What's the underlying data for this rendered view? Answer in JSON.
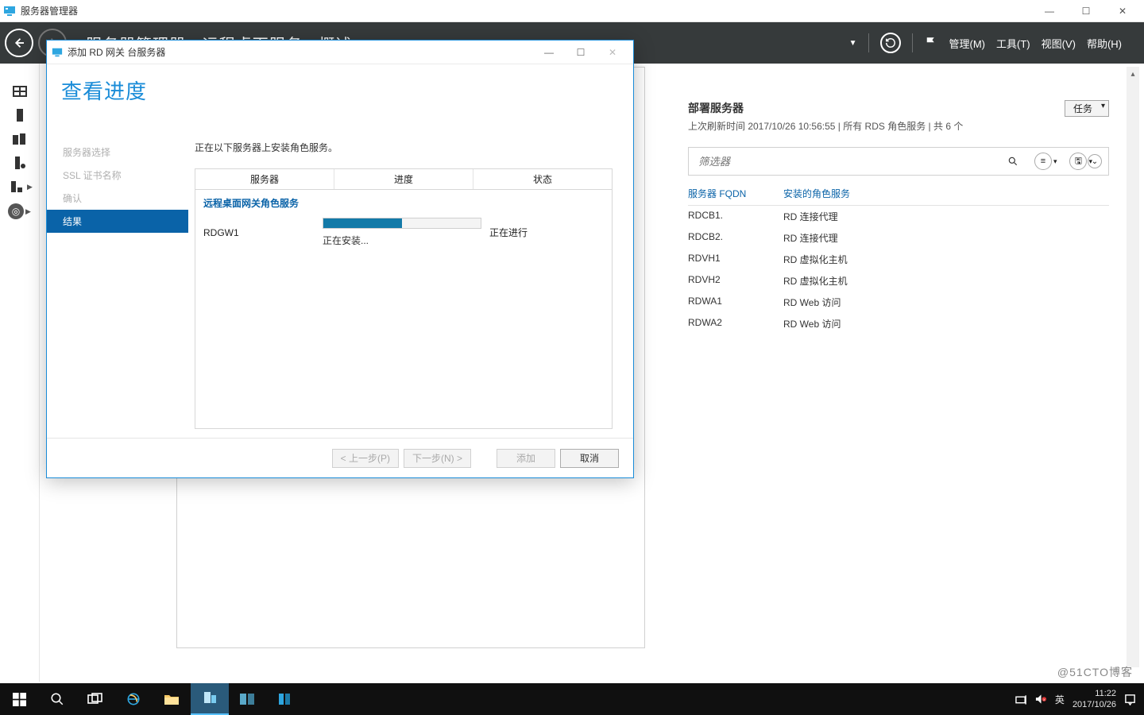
{
  "window": {
    "title": "服务器管理器",
    "breadcrumb": "服务器管理器 · 远程桌面服务 · 概述"
  },
  "header_menu": {
    "manage": "管理(M)",
    "tools": "工具(T)",
    "view": "视图(V)",
    "help": "帮助(H)"
  },
  "deploy": {
    "title": "部署服务器",
    "subline": "上次刷新时间 2017/10/26 10:56:55 | 所有 RDS 角色服务  | 共 6 个",
    "tasks": "任务",
    "filter_placeholder": "筛选器",
    "col_fqdn": "服务器 FQDN",
    "col_role": "安装的角色服务",
    "rows": [
      {
        "fqdn": "RDCB1.",
        "role": "RD 连接代理"
      },
      {
        "fqdn": "RDCB2.",
        "role": "RD 连接代理"
      },
      {
        "fqdn": "RDVH1",
        "role": "RD 虚拟化主机"
      },
      {
        "fqdn": "RDVH2",
        "role": "RD 虚拟化主机"
      },
      {
        "fqdn": "RDWA1",
        "role": "RD Web 访问"
      },
      {
        "fqdn": "RDWA2",
        "role": "RD Web 访问"
      }
    ]
  },
  "wizard": {
    "dialog_title": "添加 RD 网关 台服务器",
    "heading": "查看进度",
    "steps": {
      "s1": "服务器选择",
      "s2": "SSL 证书名称",
      "s3": "确认",
      "s4": "结果"
    },
    "intro": "正在以下服务器上安装角色服务。",
    "col_server": "服务器",
    "col_progress": "进度",
    "col_status": "状态",
    "section": "远程桌面网关角色服务",
    "row_server": "RDGW1",
    "row_sublabel": "正在安装...",
    "row_status": "正在进行",
    "btn_prev": "< 上一步(P)",
    "btn_next": "下一步(N) >",
    "btn_add": "添加",
    "btn_cancel": "取消"
  },
  "tray": {
    "ime": "英",
    "time": "11:22",
    "date": "2017/10/26"
  },
  "watermark": "@51CTO博客"
}
